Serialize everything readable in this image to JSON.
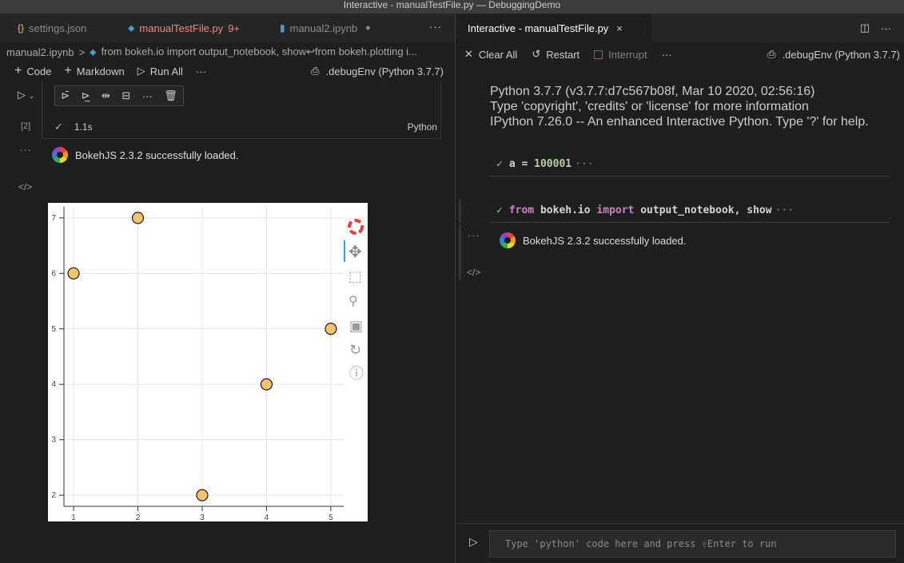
{
  "window": {
    "title": "Interactive - manualTestFile.py — DebuggingDemo"
  },
  "left_tabs": [
    {
      "icon": "{}",
      "label": "settings.json"
    },
    {
      "icon": "⬥",
      "label": "manualTestFile.py",
      "badge": "9+"
    },
    {
      "icon": "▮",
      "label": "manual2.ipynb",
      "dirty": "●"
    }
  ],
  "breadcrumb": {
    "file": "manual2.ipynb",
    "sep": ">",
    "cell": "from bokeh.io import output_notebook, show↩from bokeh.plotting i..."
  },
  "notebook_toolbar": {
    "code_label": "Code",
    "markdown_label": "Markdown",
    "run_all_label": "Run All",
    "more": "···",
    "kernel": ".debugEnv (Python 3.7.7)"
  },
  "cell": {
    "execution_count": "[2]",
    "duration": "1.1s",
    "language": "Python",
    "output_text": "BokehJS 2.3.2 successfully loaded."
  },
  "chart_data": {
    "type": "scatter",
    "x": [
      1,
      2,
      3,
      4,
      5
    ],
    "y": [
      6,
      7,
      2,
      4,
      5
    ],
    "xlim": [
      0.85,
      5.2
    ],
    "ylim": [
      1.8,
      7.2
    ],
    "x_ticks": [
      1,
      2,
      3,
      4,
      5
    ],
    "y_ticks": [
      2,
      3,
      4,
      5,
      6,
      7
    ],
    "grid": true,
    "marker_color": "#f6c36b",
    "marker_edge": "#1a1a2e"
  },
  "right_tab": {
    "label": "Interactive - manualTestFile.py",
    "close": "×"
  },
  "interactive_toolbar": {
    "clear_all": "Clear All",
    "restart": "Restart",
    "interrupt": "Interrupt",
    "more": "···",
    "kernel": ".debugEnv (Python 3.7.7)"
  },
  "banner": [
    "Python 3.7.7 (v3.7.7:d7c567b08f, Mar 10 2020, 02:56:16)",
    "Type 'copyright', 'credits' or 'license' for more information",
    "IPython 7.26.0 -- An enhanced Interactive Python. Type '?' for help."
  ],
  "history": [
    {
      "code_var": "a",
      "code_op": "=",
      "code_val": "100001"
    },
    {
      "kw1": "from",
      "mod": "bokeh.io",
      "kw2": "import",
      "names": "output_notebook, show"
    }
  ],
  "ellipsis": "···",
  "right_output_text": "BokehJS 2.3.2 successfully loaded.",
  "input": {
    "placeholder": "Type 'python' code here and press ⇧Enter to run"
  },
  "colors": {
    "accent": "#007acc",
    "success": "#89d185",
    "error_tab": "#f48771"
  }
}
